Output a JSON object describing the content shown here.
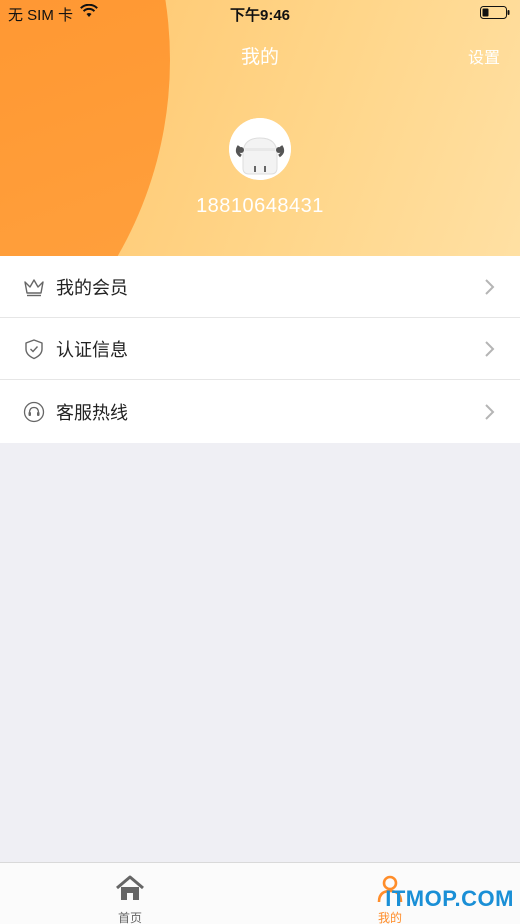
{
  "status_bar": {
    "carrier": "无 SIM 卡",
    "time": "下午9:46"
  },
  "nav": {
    "title": "我的",
    "settings_label": "设置"
  },
  "profile": {
    "phone": "18810648431"
  },
  "menu": {
    "items": [
      {
        "label": "我的会员",
        "icon": "crown-icon"
      },
      {
        "label": "认证信息",
        "icon": "shield-check-icon"
      },
      {
        "label": "客服热线",
        "icon": "headset-icon"
      }
    ]
  },
  "tabbar": {
    "tabs": [
      {
        "label": "首页",
        "icon": "home-icon",
        "active": false
      },
      {
        "label": "我的",
        "icon": "person-icon",
        "active": true
      }
    ]
  },
  "watermark": "ITMOP.COM",
  "colors": {
    "accent": "#ff8d2a",
    "header_light": "#ffd68a",
    "background": "#efeff4"
  }
}
